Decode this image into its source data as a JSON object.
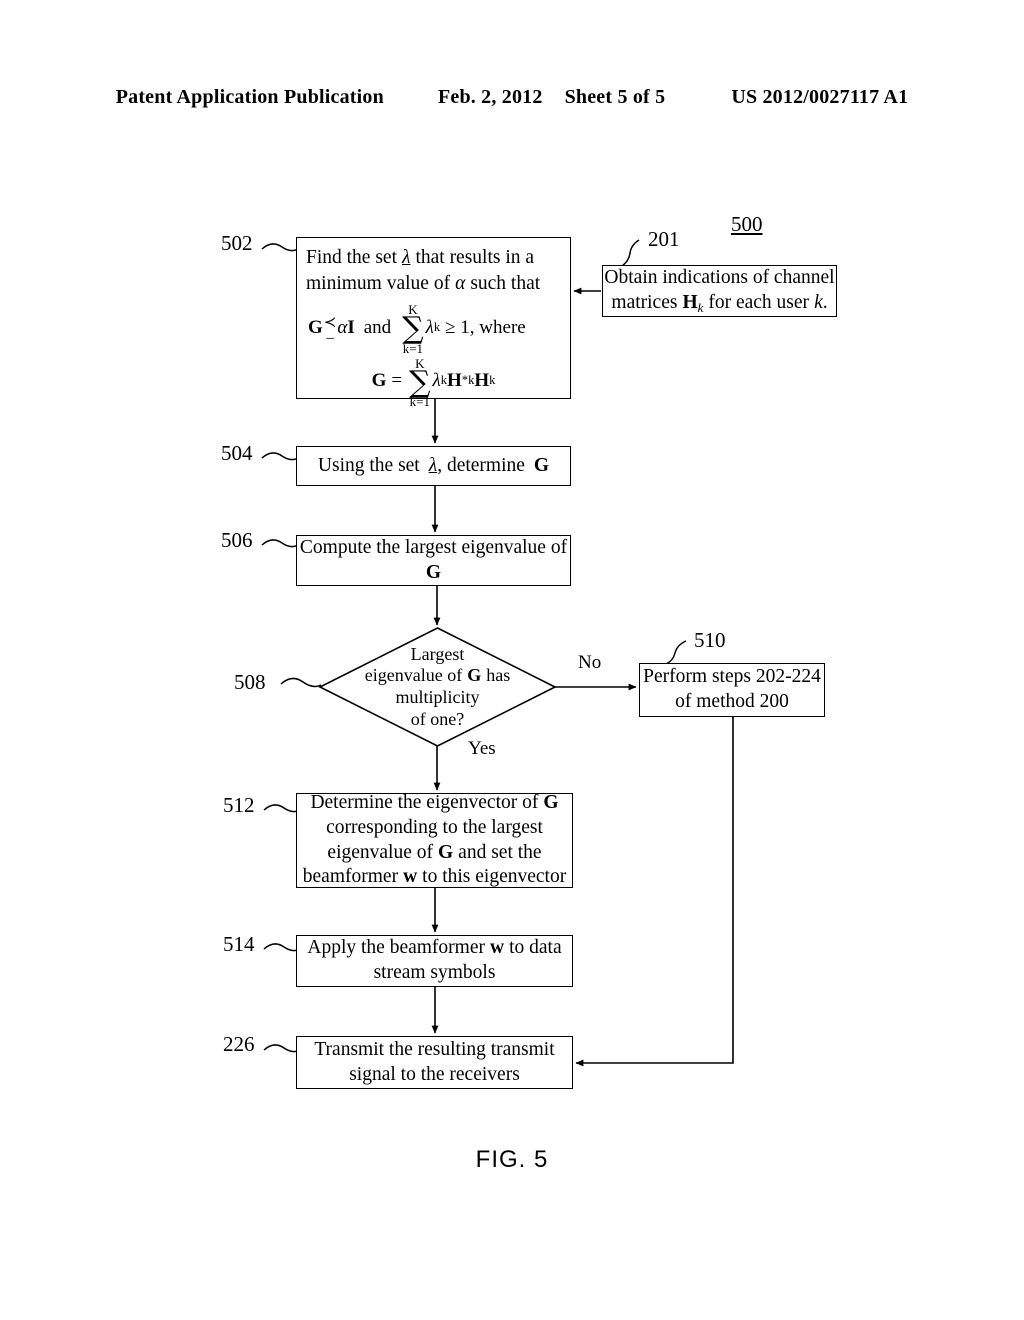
{
  "header": {
    "publication": "Patent Application Publication",
    "date": "Feb. 2, 2012",
    "sheet": "Sheet 5 of 5",
    "doc_number": "US 2012/0027117 A1"
  },
  "figure": {
    "caption": "FIG. 5",
    "figure_ref": "500"
  },
  "nodes": {
    "n502": {
      "ref": "502",
      "line1": "Find the set",
      "lambda": "λ",
      "line1b": "that results in a",
      "line2": "minimum value of",
      "alpha": "α",
      "line2b": "such that",
      "eq1_lhs": "G",
      "eq1_preceq_top": "≺",
      "eq1_preceq_bot": "_",
      "eq1_alpha": "α",
      "eq1_I": "I",
      "eq1_and": "and",
      "eq1_sigma_top": "K",
      "eq1_sigma": "∑",
      "eq1_sigma_bot": "k=1",
      "eq1_lambda": "λ",
      "eq1_lambda_sub": "k",
      "eq1_geq": "≥ 1",
      "eq1_where": ", where",
      "eq2_G": "G",
      "eq2_eq": "=",
      "eq2_sigma_top": "K",
      "eq2_sigma": "∑",
      "eq2_sigma_bot": "k=1",
      "eq2_lambda": "λ",
      "eq2_lambda_sub": "k",
      "eq2_H1": "H",
      "eq2_H1_sup": "*",
      "eq2_H1_sub": "k",
      "eq2_H2": "H",
      "eq2_H2_sub": "k"
    },
    "n201": {
      "ref": "201",
      "line1": "Obtain indications of channel",
      "line2_a": "matrices",
      "line2_H": "H",
      "line2_Hsub": "k",
      "line2_b": "for each user",
      "line2_k": "k",
      "line2_c": "."
    },
    "n504": {
      "ref": "504",
      "text_a": "Using the set",
      "lambda": "λ",
      "text_b": ", determine",
      "G": "G"
    },
    "n506": {
      "ref": "506",
      "line1": "Compute the largest eigenvalue of",
      "line2": "G"
    },
    "n508": {
      "ref": "508",
      "line1": "Largest",
      "line2_a": "eigenvalue of",
      "line2_G": "G",
      "line2_b": "has",
      "line3": "multiplicity",
      "line4": "of one?",
      "branch_no": "No",
      "branch_yes": "Yes"
    },
    "n510": {
      "ref": "510",
      "line1": "Perform steps 202-224",
      "line2": "of method 200"
    },
    "n512": {
      "ref": "512",
      "line1_a": "Determine the eigenvector of",
      "line1_G": "G",
      "line2": "corresponding to the largest",
      "line3_a": "eigenvalue of",
      "line3_G": "G",
      "line3_b": "and set the",
      "line4_a": "beamformer",
      "line4_w": "w",
      "line4_b": "to this eigenvector"
    },
    "n514": {
      "ref": "514",
      "line1_a": "Apply the beamformer",
      "line1_w": "w",
      "line1_b": "to data",
      "line2": "stream symbols"
    },
    "n226": {
      "ref": "226",
      "line1": "Transmit the resulting transmit",
      "line2": "signal to the receivers"
    }
  },
  "colors": {
    "ink": "#000000",
    "paper": "#ffffff"
  }
}
